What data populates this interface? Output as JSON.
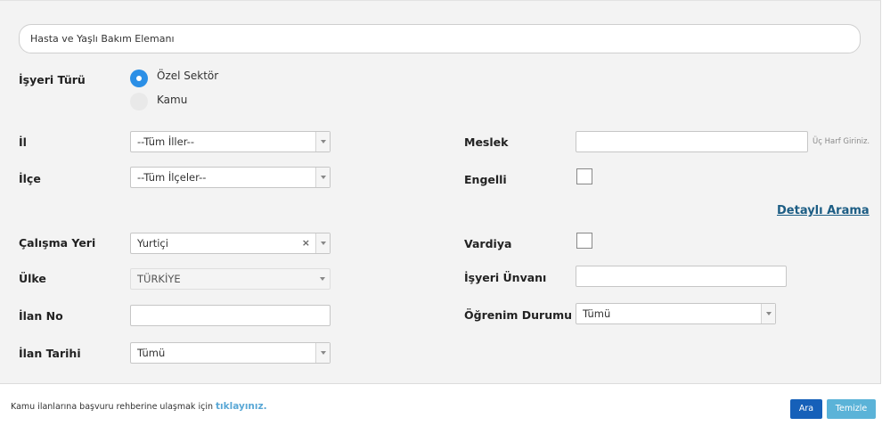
{
  "search": {
    "keyword": "Hasta ve Yaşlı Bakım Elemanı"
  },
  "workplace_type": {
    "label": "İşyeri Türü",
    "options": [
      {
        "label": "Özel Sektör",
        "selected": true
      },
      {
        "label": "Kamu",
        "selected": false
      }
    ]
  },
  "left": {
    "il": {
      "label": "İl",
      "value": "--Tüm İller--"
    },
    "ilce": {
      "label": "İlçe",
      "value": "--Tüm İlçeler--"
    },
    "calisma_yeri": {
      "label": "Çalışma Yeri",
      "value": "Yurtiçi",
      "clear": "×"
    },
    "ulke": {
      "label": "Ülke",
      "value": "TÜRKİYE"
    },
    "ilan_no": {
      "label": "İlan No",
      "value": ""
    },
    "ilan_tarihi": {
      "label": "İlan Tarihi",
      "value": "Tümü"
    }
  },
  "right": {
    "meslek": {
      "label": "Meslek",
      "value": "",
      "hint": "Üç Harf Giriniz."
    },
    "engelli": {
      "label": "Engelli",
      "checked": false
    },
    "detailed_search": "Detaylı Arama",
    "vardiya": {
      "label": "Vardiya",
      "checked": false
    },
    "isyeri_unvani": {
      "label": "İşyeri Ünvanı",
      "value": ""
    },
    "ogrenim": {
      "label": "Öğrenim Durumu",
      "value": "Tümü"
    }
  },
  "footer": {
    "text": "Kamu ilanlarına başvuru rehberine ulaşmak için",
    "link": "tıklayınız.",
    "search_button": "Ara",
    "clear_button": "Temizle"
  },
  "colors": {
    "accent": "#2b8fe6",
    "primary_button": "#1660b9",
    "secondary_button": "#5bb3d8",
    "link": "#1c5d84"
  }
}
